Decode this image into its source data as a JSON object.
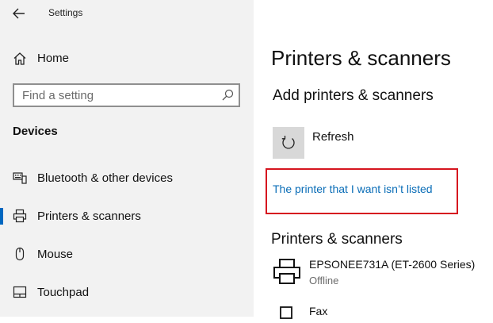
{
  "window": {
    "title": "Settings"
  },
  "sidebar": {
    "home_label": "Home",
    "search": {
      "placeholder": "Find a setting"
    },
    "section_title": "Devices",
    "items": [
      {
        "label": "Bluetooth & other devices",
        "icon": "bluetooth-devices-icon",
        "selected": false
      },
      {
        "label": "Printers & scanners",
        "icon": "printer-icon",
        "selected": true
      },
      {
        "label": "Mouse",
        "icon": "mouse-icon",
        "selected": false
      },
      {
        "label": "Touchpad",
        "icon": "touchpad-icon",
        "selected": false
      }
    ],
    "accent_color": "#0067c0"
  },
  "main": {
    "title": "Printers & scanners",
    "add_section_title": "Add printers & scanners",
    "refresh_label": "Refresh",
    "not_listed_link": "The printer that I want isn’t listed",
    "highlight_color": "#d6151f",
    "link_color": "#0a6db7",
    "list_section_title": "Printers & scanners",
    "devices": [
      {
        "name": "EPSONEE731A (ET-2600 Series)",
        "status": "Offline",
        "icon": "printer-icon"
      },
      {
        "name": "Fax",
        "status": "",
        "icon": "fax-icon"
      }
    ]
  }
}
